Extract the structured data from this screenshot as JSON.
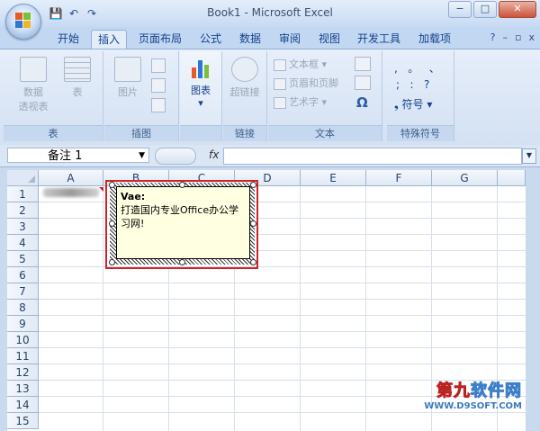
{
  "window": {
    "title": "Book1 - Microsoft Excel",
    "min": "−",
    "max": "□",
    "close": "✕"
  },
  "qat": {
    "save": "💾",
    "undo": "↶",
    "redo": "↷"
  },
  "tabs": [
    {
      "label": "开始"
    },
    {
      "label": "插入"
    },
    {
      "label": "页面布局"
    },
    {
      "label": "公式"
    },
    {
      "label": "数据"
    },
    {
      "label": "审阅"
    },
    {
      "label": "视图"
    },
    {
      "label": "开发工具"
    },
    {
      "label": "加载项"
    }
  ],
  "tab_icons": {
    "help": "?",
    "min": "–",
    "restore": "▫",
    "close": "x"
  },
  "ribbon": {
    "groups": {
      "table": {
        "label": "表",
        "pivot1": "数据",
        "pivot2": "透视表",
        "table_btn": "表"
      },
      "illustrations": {
        "label": "插图",
        "picture": "图片"
      },
      "charts": {
        "label": "",
        "chart": "图表"
      },
      "links": {
        "label": "链接",
        "hyperlink": "超链接"
      },
      "text": {
        "label": "文本",
        "textbox": "文本框",
        "header_footer": "页眉和页脚",
        "wordart": "艺术字",
        "omega": "Ω"
      },
      "symbols": {
        "label": "特殊符号",
        "row1": ",   。   、",
        "row2": ";   :   ?",
        "symbol": "符号"
      }
    }
  },
  "formula_bar": {
    "name_box": "备注 1",
    "fx": "fx",
    "value": ""
  },
  "columns": [
    "A",
    "B",
    "C",
    "D",
    "E",
    "F",
    "G"
  ],
  "rows": [
    "1",
    "2",
    "3",
    "4",
    "5",
    "6",
    "7",
    "8",
    "9",
    "10",
    "11",
    "12",
    "13",
    "14",
    "15"
  ],
  "comment": {
    "author": "Vae:",
    "text": "打造国内专业Office办公学习网!"
  },
  "watermark": {
    "line1a": "第九",
    "line1b": "软件网",
    "line2": "WWW.D9SOFT.COM"
  }
}
